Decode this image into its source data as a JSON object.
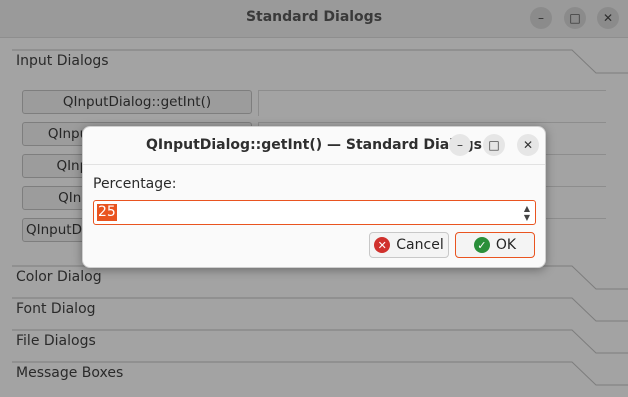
{
  "window": {
    "title": "Standard Dialogs",
    "minimize_glyph": "–",
    "maximize_glyph": "□",
    "close_glyph": "✕"
  },
  "sections": [
    {
      "label": "Input Dialogs"
    },
    {
      "label": "Color Dialog"
    },
    {
      "label": "Font Dialog"
    },
    {
      "label": "File Dialogs"
    },
    {
      "label": "Message Boxes"
    }
  ],
  "input_buttons": [
    {
      "label": "QInputDialog::getInt()"
    },
    {
      "label": "QInputDialog::getDouble()"
    },
    {
      "label": "QInputDialog::getItem()"
    },
    {
      "label": "QInputDialog::getText()"
    },
    {
      "label": "QInputDialog::getMultiLineText()"
    }
  ],
  "dialog": {
    "title": "QInputDialog::getInt() — Standard Dialogs",
    "prompt_label": "Percentage:",
    "spin_value": "25",
    "spin_up": "▲",
    "spin_down": "▼",
    "cancel": {
      "label": "Cancel",
      "icon": "cancel-icon",
      "glyph": "✕",
      "color": "#d0312d"
    },
    "ok": {
      "label": "OK",
      "icon": "ok-check-icon",
      "glyph": "✓",
      "color": "#2a8f3a"
    },
    "accent_color": "#e95420"
  }
}
